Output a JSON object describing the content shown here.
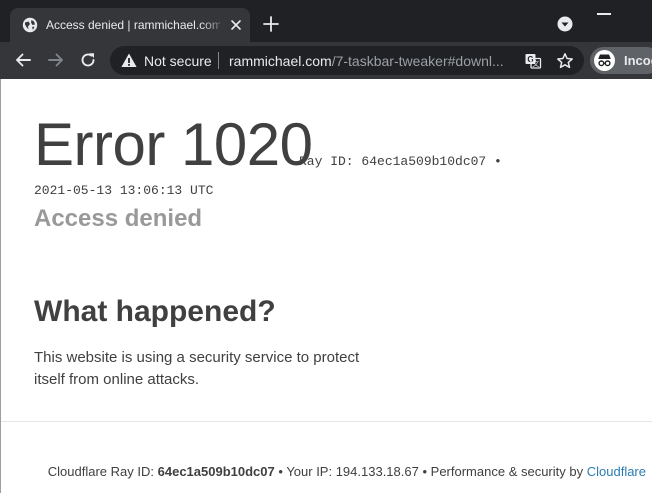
{
  "browser": {
    "tab_title": "Access denied | rammichael.com",
    "security_label": "Not secure",
    "url_domain": "rammichael.com",
    "url_path": "/7-taskbar-tweaker#downl...",
    "incognito_label": "Incog"
  },
  "error": {
    "title": "Error 1020",
    "ray_inline": "Ray ID: 64ec1a509b10dc07 •",
    "timestamp": "2021-05-13 13:06:13 UTC",
    "subtitle": "Access denied"
  },
  "what_happened": {
    "heading": "What happened?",
    "body": "This website is using a security service to protect itself from online attacks."
  },
  "footer": {
    "ray_label": "Cloudflare Ray ID:",
    "ray_id": "64ec1a509b10dc07",
    "separator": "•",
    "ip_text": "Your IP: 194.133.18.67",
    "perf_text": "Performance & security by",
    "cloudflare_link": "Cloudflare"
  },
  "colors": {
    "chrome_dark": "#202124",
    "chrome_tab": "#35363a",
    "text_dark": "#404040",
    "text_muted": "#999999",
    "link": "#2c7cb0"
  }
}
